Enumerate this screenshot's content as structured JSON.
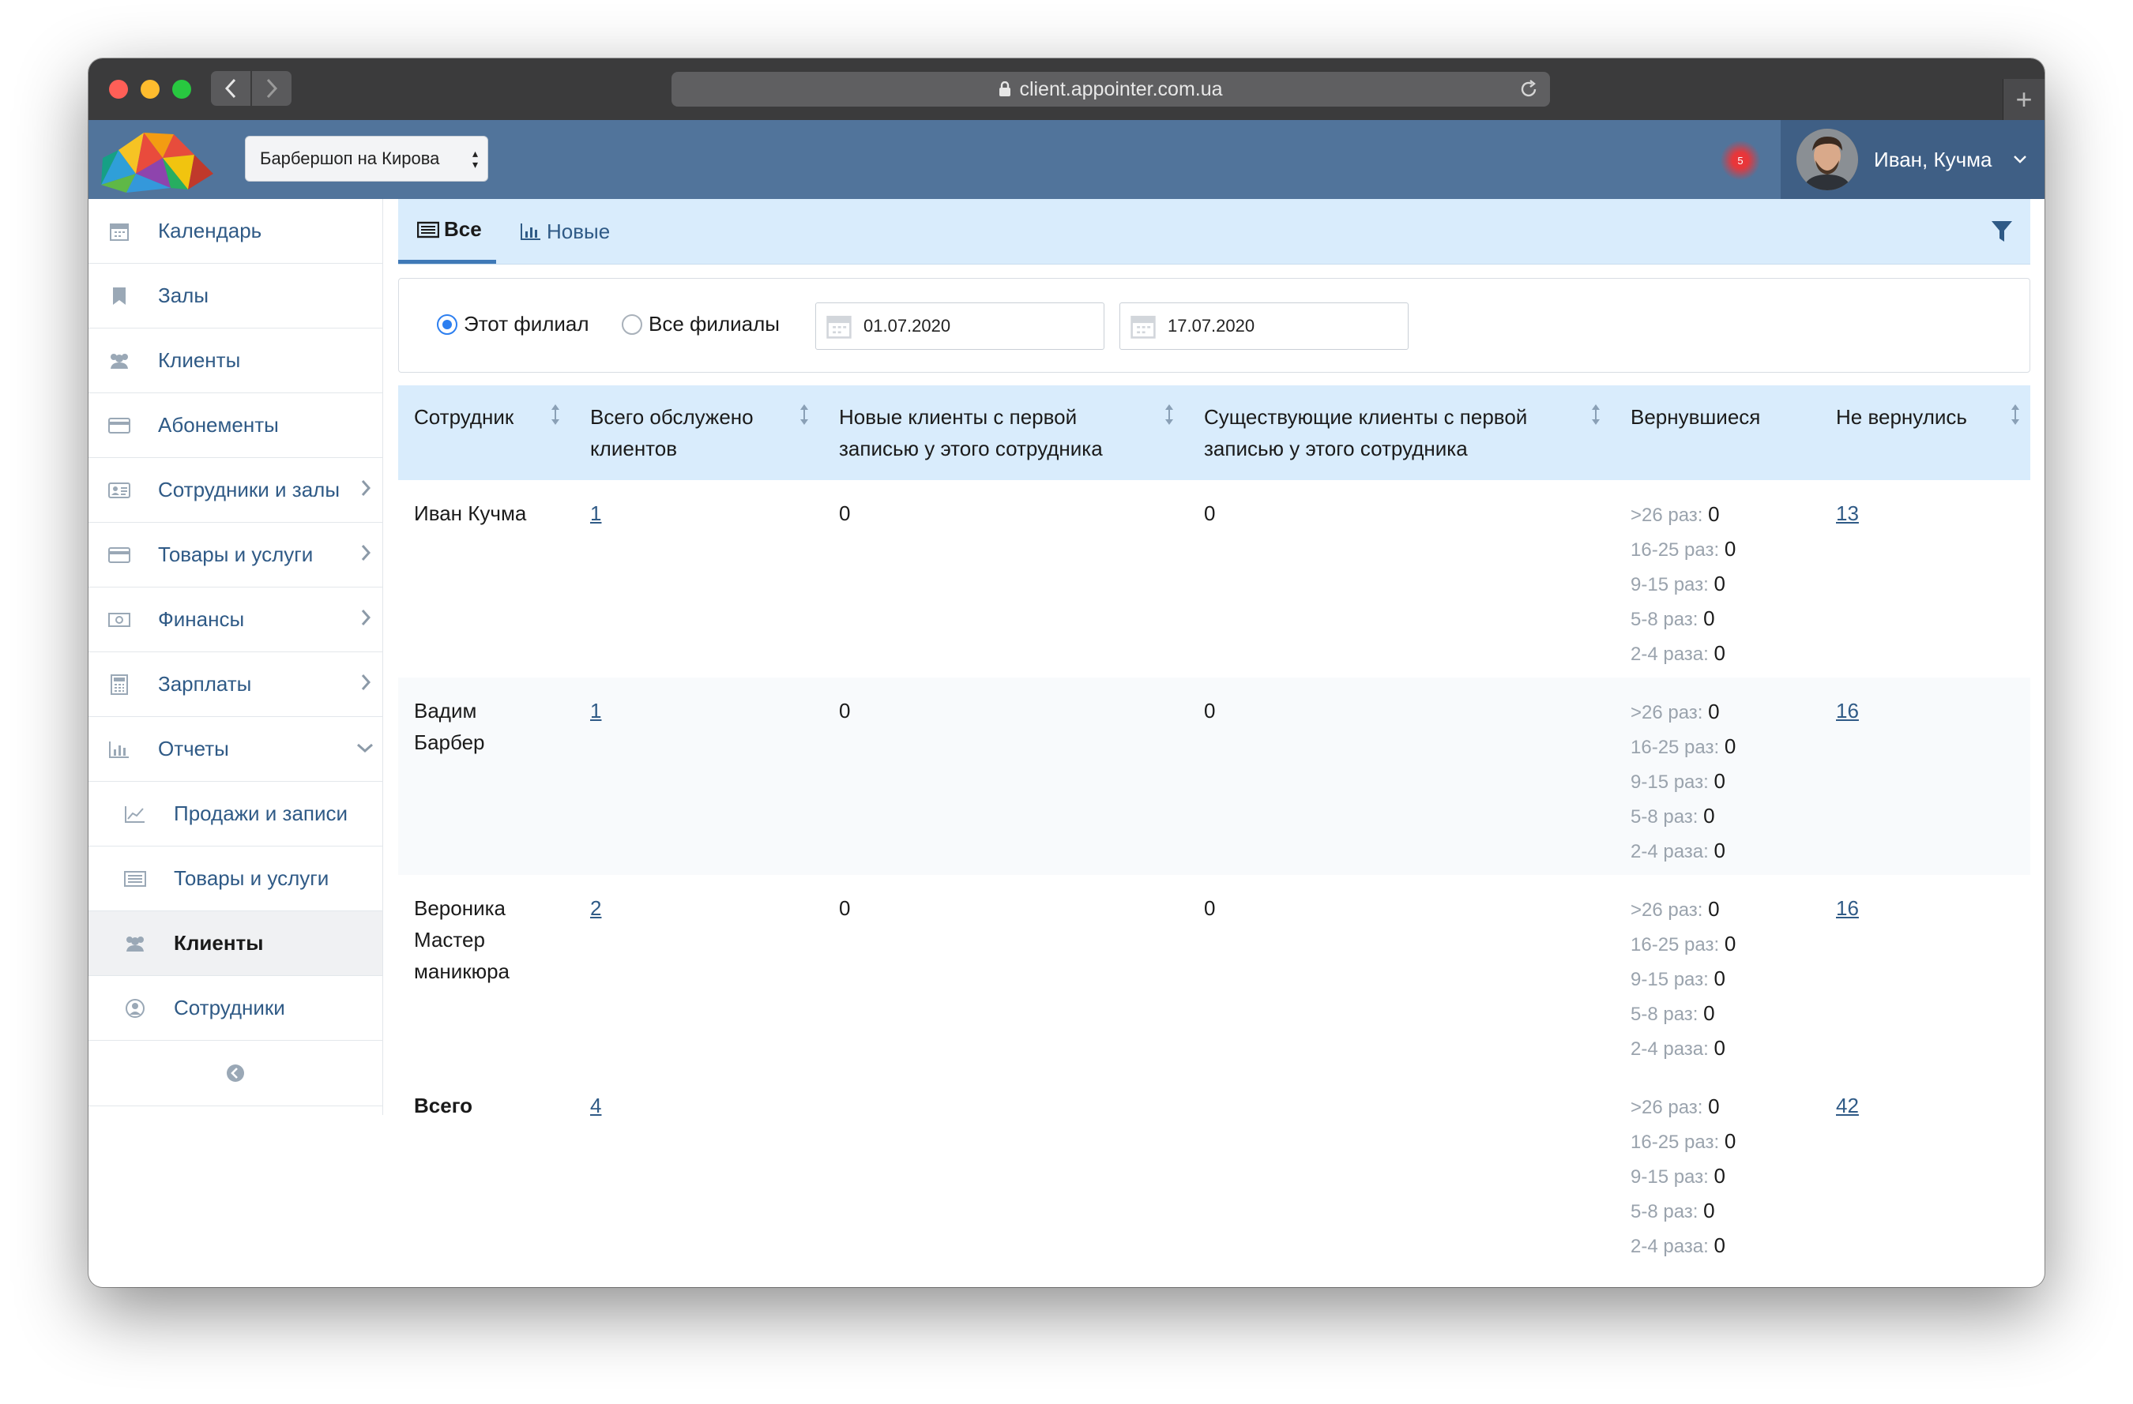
{
  "browser": {
    "url": "client.appointer.com.ua"
  },
  "header": {
    "branch": "Барбершоп на Кирова",
    "notification_count": "5",
    "user_name": "Иван, Кучма"
  },
  "sidebar": {
    "items": [
      {
        "label": "Календарь",
        "icon": "calendar-icon"
      },
      {
        "label": "Залы",
        "icon": "bookmark-icon"
      },
      {
        "label": "Клиенты",
        "icon": "users-icon"
      },
      {
        "label": "Абонементы",
        "icon": "card-icon"
      },
      {
        "label": "Сотрудники и залы",
        "icon": "id-card-icon"
      },
      {
        "label": "Товары и услуги",
        "icon": "card-icon"
      },
      {
        "label": "Финансы",
        "icon": "money-icon"
      },
      {
        "label": "Зарплаты",
        "icon": "calculator-icon"
      },
      {
        "label": "Отчеты",
        "icon": "bar-chart-icon"
      },
      {
        "label": "Продажи и записи",
        "icon": "line-chart-icon"
      },
      {
        "label": "Товары и услуги",
        "icon": "list-icon"
      },
      {
        "label": "Клиенты",
        "icon": "users-icon"
      },
      {
        "label": "Сотрудники",
        "icon": "user-circle-icon"
      }
    ]
  },
  "tabs": {
    "all": "Все",
    "new": "Новые"
  },
  "filters": {
    "this_branch": "Этот филиал",
    "all_branches": "Все филиалы",
    "date_from": "01.07.2020",
    "date_to": "17.07.2020"
  },
  "table": {
    "headers": {
      "employee": "Сотрудник",
      "total_served_1": "Всего обслужено",
      "total_served_2": "клиентов",
      "new_clients_1": "Новые клиенты с первой",
      "new_clients_2": "записью у этого сотрудника",
      "existing_clients_1": "Существующие клиенты с первой",
      "existing_clients_2": "записью у этого сотрудника",
      "returned": "Вернувшиеся",
      "not_returned": "Не вернулись"
    },
    "return_labels": [
      ">26 раз:",
      "16-25 раз:",
      "9-15 раз:",
      "5-8 раз:",
      "2-4 раза:"
    ],
    "rows": [
      {
        "name_lines": [
          "Иван Кучма"
        ],
        "total": "1",
        "new": "0",
        "existing": "0",
        "returned": [
          "0",
          "0",
          "0",
          "0",
          "0"
        ],
        "not_returned": "13"
      },
      {
        "name_lines": [
          "Вадим",
          "Барбер"
        ],
        "total": "1",
        "new": "0",
        "existing": "0",
        "returned": [
          "0",
          "0",
          "0",
          "0",
          "0"
        ],
        "not_returned": "16"
      },
      {
        "name_lines": [
          "Вероника",
          "Мастер",
          "маникюра"
        ],
        "total": "2",
        "new": "0",
        "existing": "0",
        "returned": [
          "0",
          "0",
          "0",
          "0",
          "0"
        ],
        "not_returned": "16"
      }
    ],
    "totals": {
      "label": "Всего",
      "total": "4",
      "returned": [
        "0",
        "0",
        "0",
        "0",
        "0"
      ],
      "not_returned": "42"
    }
  }
}
